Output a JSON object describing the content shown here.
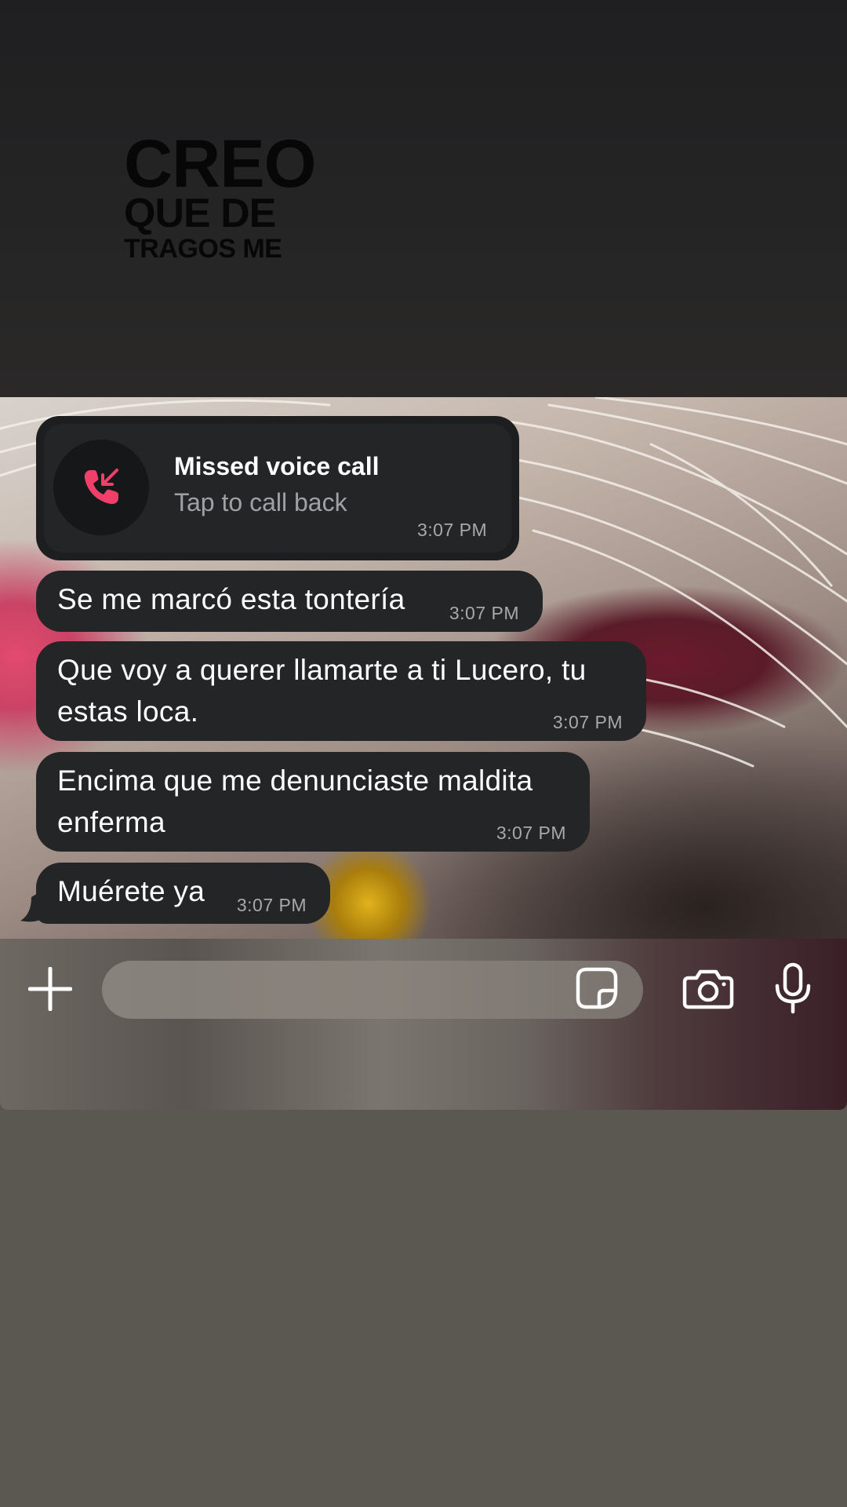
{
  "caption": {
    "line1": "CREO",
    "line2": "QUE DE",
    "line3": "TRAGOS ME"
  },
  "call": {
    "title": "Missed voice call",
    "subtitle": "Tap to call back",
    "time": "3:07 PM",
    "icon": "missed-call-icon",
    "icon_color": "#f0406a"
  },
  "messages": [
    {
      "text": "Se me marcó esta tontería",
      "time": "3:07 PM"
    },
    {
      "text": "Que voy a querer llamarte a ti Lucero, tu\nestas loca.",
      "time": "3:07 PM"
    },
    {
      "text": "Encima que me denunciaste maldita\nenferma",
      "time": "3:07 PM"
    },
    {
      "text": "Muérete ya",
      "time": "3:07 PM"
    }
  ],
  "input_bar": {
    "plus_icon": "plus-icon",
    "sticker_icon": "sticker-icon",
    "camera_icon": "camera-icon",
    "mic_icon": "microphone-icon"
  }
}
